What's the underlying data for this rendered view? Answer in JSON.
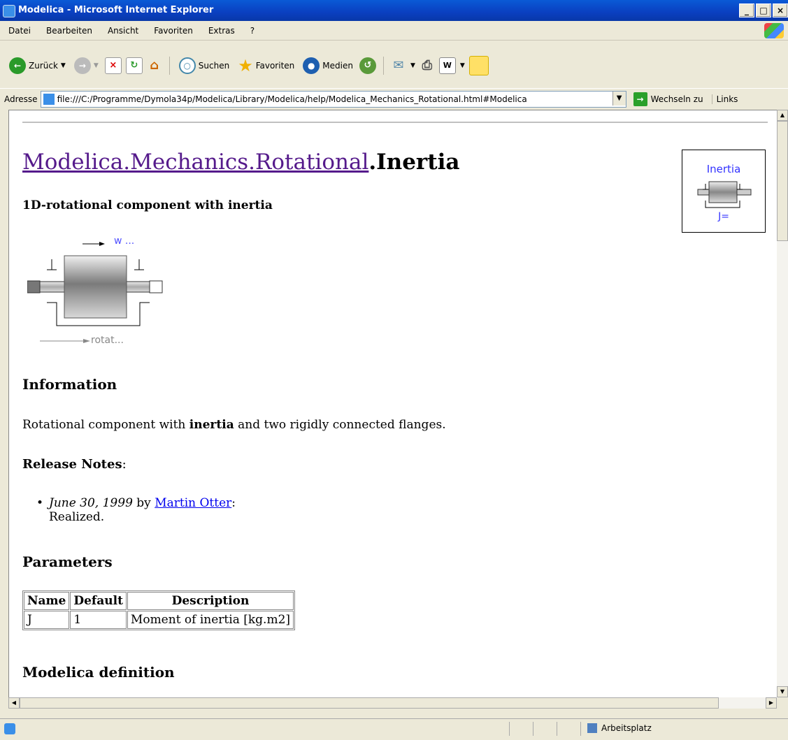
{
  "window": {
    "title": "Modelica - Microsoft Internet Explorer"
  },
  "menu": [
    "Datei",
    "Bearbeiten",
    "Ansicht",
    "Favoriten",
    "Extras",
    "?"
  ],
  "toolbar": {
    "back": "Zurück",
    "search": "Suchen",
    "favorites": "Favoriten",
    "media": "Medien"
  },
  "address": {
    "label": "Adresse",
    "url": "file:///C:/Programme/Dymola34p/Modelica/Library/Modelica/help/Modelica_Mechanics_Rotational.html#Modelica",
    "go": "Wechseln zu",
    "links": "Links"
  },
  "doc": {
    "heading_link": "Modelica.Mechanics.Rotational",
    "heading_rest": ".Inertia",
    "subtitle": "1D-rotational component with inertia",
    "icon_label": "Inertia",
    "icon_param": "J=",
    "diagram_top_label": "w ...",
    "diagram_bottom_label": "rotat...",
    "info_heading": "Information",
    "info_text_1": "Rotational component with ",
    "info_bold": "inertia",
    "info_text_2": " and two rigidly connected flanges.",
    "release_heading": "Release Notes",
    "release_colon": ":",
    "release_date": "June 30, 1999",
    "release_by": " by ",
    "release_author": "Martin Otter",
    "release_note": "Realized.",
    "params_heading": "Parameters",
    "params_columns": [
      "Name",
      "Default",
      "Description"
    ],
    "params_rows": [
      [
        "J",
        "1",
        "Moment of inertia [kg.m2]"
      ]
    ],
    "definition_heading": "Modelica definition"
  },
  "status": {
    "zone": "Arbeitsplatz"
  }
}
